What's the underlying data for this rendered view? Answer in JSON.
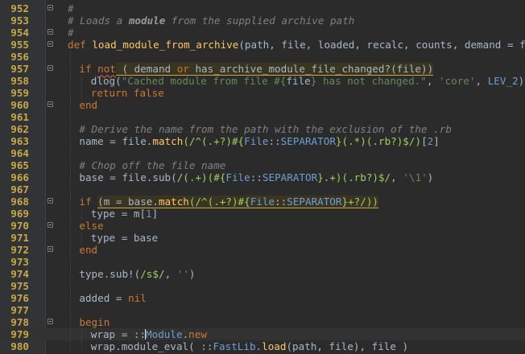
{
  "editor": {
    "language": "ruby",
    "current_line": 979,
    "lines": [
      {
        "n": "952",
        "fold": "open",
        "indent": 0,
        "tokens": [
          {
            "c": "cm",
            "t": "#"
          }
        ]
      },
      {
        "n": "953",
        "fold": "none",
        "indent": 0,
        "tokens": [
          {
            "c": "cm",
            "t": "# Loads a "
          },
          {
            "c": "cmb",
            "t": "module"
          },
          {
            "c": "cm",
            "t": " from the supplied archive path"
          }
        ]
      },
      {
        "n": "954",
        "fold": "open",
        "indent": 0,
        "tokens": [
          {
            "c": "cm",
            "t": "#"
          }
        ]
      },
      {
        "n": "955",
        "fold": "open",
        "indent": 0,
        "tokens": [
          {
            "c": "kw",
            "t": "def "
          },
          {
            "c": "fn",
            "t": "load_module_from_archive"
          },
          {
            "c": "plain",
            "t": "(path, file, loaded, recalc, counts, demand = false)"
          }
        ]
      },
      {
        "n": "956",
        "fold": "none",
        "indent": 1,
        "tokens": [
          {
            "c": "plain",
            "t": ""
          }
        ]
      },
      {
        "n": "957",
        "fold": "open",
        "indent": 1,
        "tokens": [
          {
            "c": "kw",
            "t": "if "
          },
          {
            "c": "kw",
            "t": "not",
            "u": "bad"
          },
          {
            "c": "plain",
            "t": " ( demand ",
            "h": true
          },
          {
            "c": "kw",
            "t": "or",
            "h": true
          },
          {
            "c": "plain",
            "t": " has_archive_module_file_changed?(file))",
            "h": true
          }
        ]
      },
      {
        "n": "958",
        "fold": "none",
        "indent": 2,
        "tokens": [
          {
            "c": "plain",
            "t": "dlog("
          },
          {
            "c": "st",
            "t": "\"Cached module from file #{"
          },
          {
            "c": "plain",
            "t": "file"
          },
          {
            "c": "st",
            "t": "} has not changed.\""
          },
          {
            "c": "plain",
            "t": ", "
          },
          {
            "c": "st",
            "t": "'core'"
          },
          {
            "c": "plain",
            "t": ", "
          },
          {
            "c": "cn",
            "t": "LEV_2"
          },
          {
            "c": "plain",
            "t": ")"
          }
        ]
      },
      {
        "n": "959",
        "fold": "none",
        "indent": 2,
        "tokens": [
          {
            "c": "kw",
            "t": "return false"
          }
        ]
      },
      {
        "n": "960",
        "fold": "open",
        "indent": 1,
        "tokens": [
          {
            "c": "kw",
            "t": "end"
          }
        ]
      },
      {
        "n": "961",
        "fold": "none",
        "indent": 1,
        "tokens": [
          {
            "c": "plain",
            "t": ""
          }
        ]
      },
      {
        "n": "962",
        "fold": "none",
        "indent": 1,
        "tokens": [
          {
            "c": "cm",
            "t": "# Derive the name from the path with the exclusion of the .rb"
          }
        ]
      },
      {
        "n": "963",
        "fold": "none",
        "indent": 1,
        "tokens": [
          {
            "c": "plain",
            "t": "name = file."
          },
          {
            "c": "fn",
            "t": "match"
          },
          {
            "c": "rx",
            "t": "(/^(.+?)#{"
          },
          {
            "c": "cn",
            "t": "File"
          },
          {
            "c": "plain",
            "t": "::"
          },
          {
            "c": "cn",
            "t": "SEPARATOR"
          },
          {
            "c": "rx",
            "t": "}(.*)(.rb?)$/)"
          },
          {
            "c": "plain",
            "t": "["
          },
          {
            "c": "nm",
            "t": "2"
          },
          {
            "c": "plain",
            "t": "]"
          }
        ]
      },
      {
        "n": "964",
        "fold": "none",
        "indent": 1,
        "tokens": [
          {
            "c": "plain",
            "t": ""
          }
        ]
      },
      {
        "n": "965",
        "fold": "none",
        "indent": 1,
        "tokens": [
          {
            "c": "cm",
            "t": "# Chop off the file name"
          }
        ]
      },
      {
        "n": "966",
        "fold": "none",
        "indent": 1,
        "tokens": [
          {
            "c": "plain",
            "t": "base = file.sub("
          },
          {
            "c": "rx",
            "t": "/(.+)(#{"
          },
          {
            "c": "cn",
            "t": "File"
          },
          {
            "c": "plain",
            "t": "::"
          },
          {
            "c": "cn",
            "t": "SEPARATOR"
          },
          {
            "c": "rx",
            "t": "}.+)(.rb?)$/"
          },
          {
            "c": "plain",
            "t": ", "
          },
          {
            "c": "st",
            "t": "'\\1'"
          },
          {
            "c": "plain",
            "t": ")"
          }
        ]
      },
      {
        "n": "967",
        "fold": "none",
        "indent": 1,
        "tokens": [
          {
            "c": "plain",
            "t": ""
          }
        ]
      },
      {
        "n": "968",
        "fold": "open",
        "indent": 1,
        "tokens": [
          {
            "c": "kw",
            "t": "if "
          },
          {
            "c": "plain",
            "t": "(m = base.",
            "h": true
          },
          {
            "c": "fn",
            "t": "match",
            "h": true
          },
          {
            "c": "rx",
            "t": "(/^(.+?)#{",
            "h": true
          },
          {
            "c": "cn",
            "t": "File",
            "h": true
          },
          {
            "c": "plain",
            "t": "::",
            "h": true
          },
          {
            "c": "cn",
            "t": "SEPARATOR",
            "h": true
          },
          {
            "c": "rx",
            "t": "}+?/))",
            "h": true
          }
        ]
      },
      {
        "n": "969",
        "fold": "none",
        "indent": 2,
        "tokens": [
          {
            "c": "plain",
            "t": "type = m["
          },
          {
            "c": "nm",
            "t": "1"
          },
          {
            "c": "plain",
            "t": "]"
          }
        ]
      },
      {
        "n": "970",
        "fold": "open",
        "indent": 1,
        "tokens": [
          {
            "c": "kw",
            "t": "else"
          }
        ]
      },
      {
        "n": "971",
        "fold": "none",
        "indent": 2,
        "tokens": [
          {
            "c": "plain",
            "t": "type = base"
          }
        ]
      },
      {
        "n": "972",
        "fold": "open",
        "indent": 1,
        "tokens": [
          {
            "c": "kw",
            "t": "end"
          }
        ]
      },
      {
        "n": "973",
        "fold": "none",
        "indent": 1,
        "tokens": [
          {
            "c": "plain",
            "t": ""
          }
        ]
      },
      {
        "n": "974",
        "fold": "none",
        "indent": 1,
        "tokens": [
          {
            "c": "plain",
            "t": "type.sub!("
          },
          {
            "c": "rx",
            "t": "/s$/"
          },
          {
            "c": "plain",
            "t": ", "
          },
          {
            "c": "st",
            "t": "''"
          },
          {
            "c": "plain",
            "t": ")"
          }
        ]
      },
      {
        "n": "975",
        "fold": "none",
        "indent": 1,
        "tokens": [
          {
            "c": "plain",
            "t": ""
          }
        ]
      },
      {
        "n": "976",
        "fold": "none",
        "indent": 1,
        "tokens": [
          {
            "c": "plain",
            "t": "added = "
          },
          {
            "c": "kw",
            "t": "nil"
          }
        ]
      },
      {
        "n": "977",
        "fold": "none",
        "indent": 1,
        "tokens": [
          {
            "c": "plain",
            "t": ""
          }
        ]
      },
      {
        "n": "978",
        "fold": "open",
        "indent": 1,
        "tokens": [
          {
            "c": "kw",
            "t": "begin"
          }
        ]
      },
      {
        "n": "979",
        "fold": "none",
        "indent": 2,
        "tokens": [
          {
            "c": "plain",
            "t": "wrap = ::"
          },
          {
            "c": "cn",
            "t": "M",
            "caret": true
          },
          {
            "c": "cn",
            "t": "odule"
          },
          {
            "c": "plain",
            "t": "."
          },
          {
            "c": "kw",
            "t": "new"
          }
        ]
      },
      {
        "n": "980",
        "fold": "none",
        "indent": 2,
        "tokens": [
          {
            "c": "plain",
            "t": "wrap.module_eval( ::"
          },
          {
            "c": "cn",
            "t": "FastLib"
          },
          {
            "c": "plain",
            "t": "."
          },
          {
            "c": "fn",
            "t": "load"
          },
          {
            "c": "plain",
            "t": "(path, file), file )"
          }
        ]
      }
    ]
  }
}
